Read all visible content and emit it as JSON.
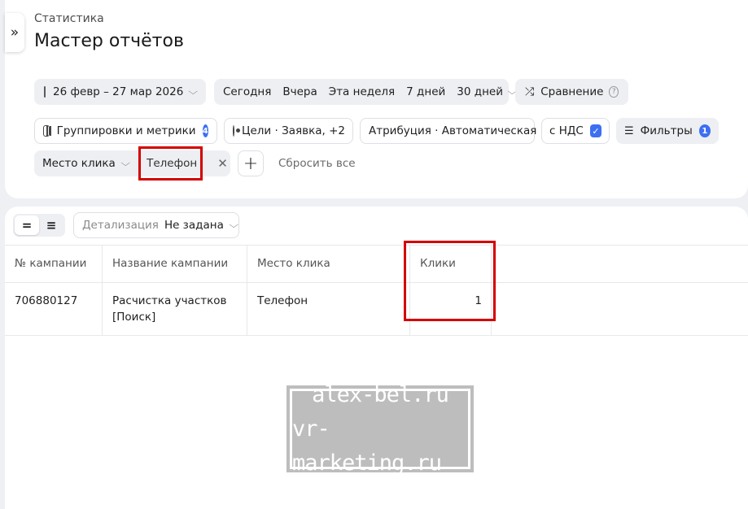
{
  "header": {
    "breadcrumb": "Статистика",
    "title": "Мастер отчётов",
    "expand_glyph": "»"
  },
  "toolbar": {
    "date_range": "26 февр – 27 мар 2026",
    "periods": [
      "Сегодня",
      "Вчера",
      "Эта неделя",
      "7 дней",
      "30 дней"
    ],
    "compare_label": "Сравнение",
    "compare_help": "?"
  },
  "settings": {
    "groupings_label": "Группировки и метрики",
    "groupings_badge": "4",
    "goals_label": "Цели · Заявка, +2",
    "attribution_label": "Атрибуция · Автоматическая",
    "vat_label": "с НДС",
    "vat_checked": true,
    "filters_label": "Фильтры",
    "filters_badge": "1"
  },
  "filter_row": {
    "field_label": "Место клика",
    "value_label": "Телефон",
    "remove_glyph": "✕",
    "add_glyph": "+",
    "reset_label": "Сбросить все"
  },
  "table_toolbar": {
    "detail_label": "Детализация",
    "detail_value": "Не задана"
  },
  "table": {
    "columns": [
      "№ кампании",
      "Название кампании",
      "Место клика",
      "Клики"
    ],
    "rows": [
      {
        "campaign_id": "706880127",
        "campaign_name_line1": "Расчистка участков",
        "campaign_name_line2": "[Поиск]",
        "click_place": "Телефон",
        "clicks": "1"
      }
    ]
  },
  "watermark": {
    "line1": "alex-bel.ru",
    "line2": "vr-marketing.ru"
  },
  "colors": {
    "accent": "#3d6ff2",
    "highlight_frame": "#d40000",
    "page_bg": "#eef0f3",
    "chip_bg": "#edeff2"
  }
}
